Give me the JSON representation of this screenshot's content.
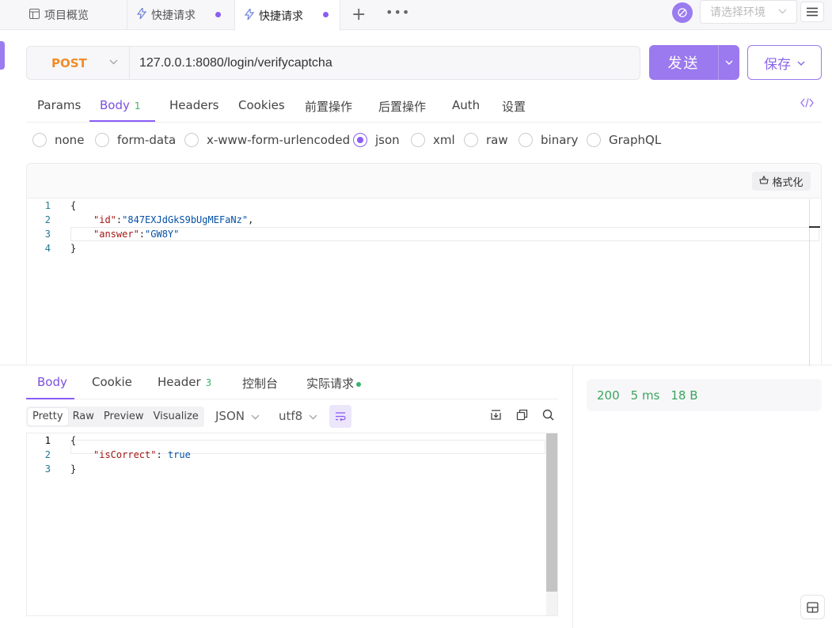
{
  "tabs": [
    {
      "icon": "layout-icon",
      "label": "项目概览"
    },
    {
      "icon": "lightning-icon",
      "label": "快捷请求"
    },
    {
      "icon": "lightning-icon",
      "label": "快捷请求"
    }
  ],
  "env_select": {
    "placeholder": "请选择环境"
  },
  "request": {
    "method": "POST",
    "url": "127.0.0.1:8080/login/verifycaptcha",
    "send_label": "发送",
    "save_label": "保存"
  },
  "request_tabs": [
    {
      "label": "Params"
    },
    {
      "label": "Body",
      "badge": "1"
    },
    {
      "label": "Headers"
    },
    {
      "label": "Cookies"
    },
    {
      "label": "前置操作"
    },
    {
      "label": "后置操作"
    },
    {
      "label": "Auth"
    },
    {
      "label": "设置"
    }
  ],
  "body_types": [
    "none",
    "form-data",
    "x-www-form-urlencoded",
    "json",
    "xml",
    "raw",
    "binary",
    "GraphQL"
  ],
  "body_type_selected": "json",
  "format_label": "格式化",
  "request_body_lines": [
    {
      "n": "1",
      "key": "",
      "sep": "",
      "val": "",
      "text": "{"
    },
    {
      "n": "2",
      "key": "\"id\"",
      "sep": ":",
      "val": "\"847EXJdGkS9bUgMEFaNz\"",
      "tail": ","
    },
    {
      "n": "3",
      "key": "\"answer\"",
      "sep": ":",
      "val": "\"GW8Y\"",
      "tail": ""
    },
    {
      "n": "4",
      "key": "",
      "sep": "",
      "val": "",
      "text": "}"
    }
  ],
  "response_tabs": [
    {
      "label": "Body"
    },
    {
      "label": "Cookie"
    },
    {
      "label": "Header",
      "badge": "3"
    },
    {
      "label": "控制台"
    },
    {
      "label": "实际请求"
    }
  ],
  "view_modes": [
    "Pretty",
    "Raw",
    "Preview",
    "Visualize"
  ],
  "view_selected": "Pretty",
  "format_dropdown": "JSON",
  "encoding_dropdown": "utf8",
  "response_body_lines": [
    {
      "n": "1",
      "text": "{"
    },
    {
      "n": "2",
      "key": "\"isCorrect\"",
      "sep": ": ",
      "val": "true"
    },
    {
      "n": "3",
      "text": "}"
    }
  ],
  "status": {
    "code": "200",
    "time": "5 ms",
    "size": "18 B"
  },
  "colors": {
    "accent": "#8b5cf6",
    "method_post": "#f08c2a",
    "success": "#3ba55d"
  }
}
